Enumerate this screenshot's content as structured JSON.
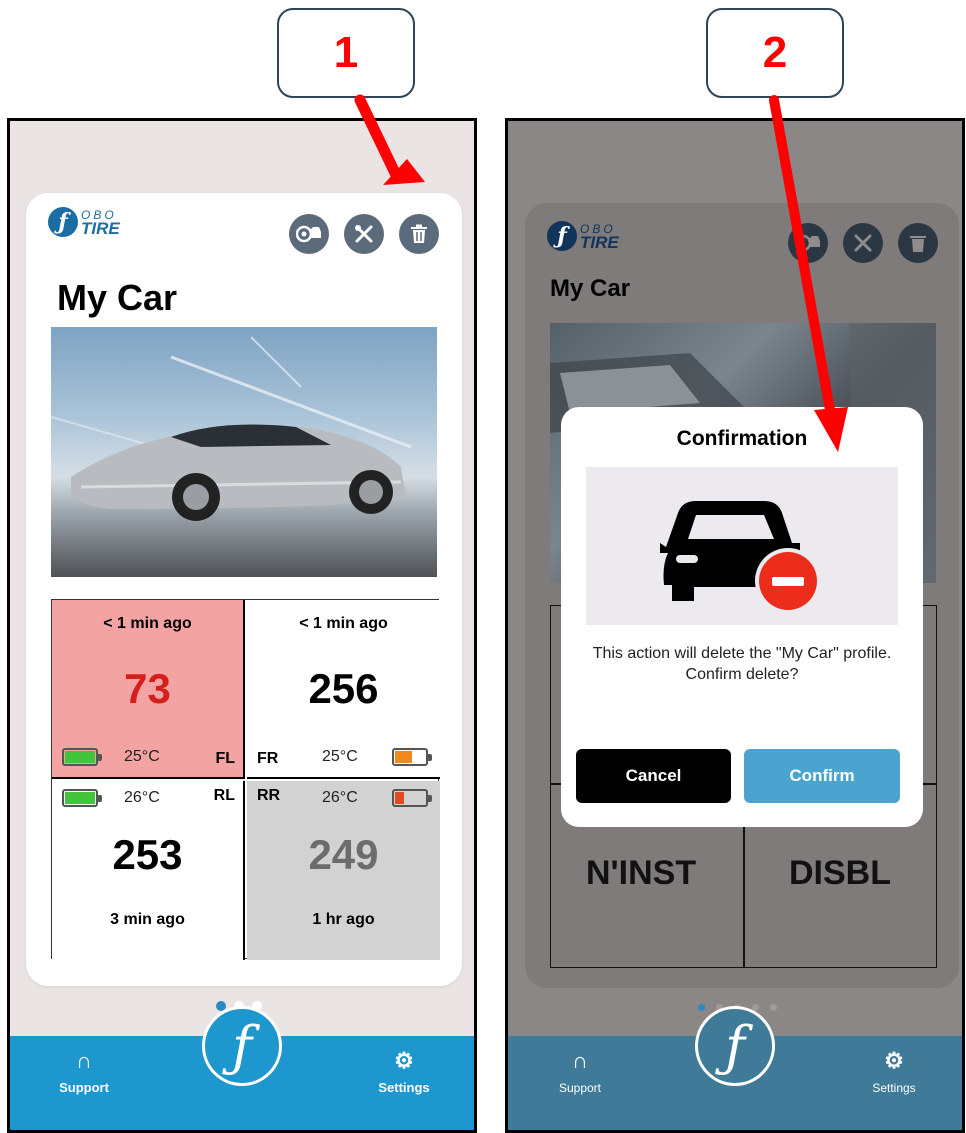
{
  "steps": [
    "1",
    "2"
  ],
  "colors": {
    "arrow": "#ff0000",
    "accent": "#1e97cf",
    "alert_cell": "#f4a3a3",
    "offline_cell": "#d2d2d2"
  },
  "logo": {
    "top": "OBO",
    "bottom": "TIRE"
  },
  "screen1": {
    "header_icons": [
      "tire-settings-icon",
      "tools-icon",
      "trash-icon"
    ],
    "car_name": "My Car",
    "tires": [
      {
        "position": "FL",
        "ago": "< 1 min ago",
        "value": "73",
        "temp": "25°C",
        "battery_level": 1.0,
        "battery_color": "#44c43b",
        "status": "alert"
      },
      {
        "position": "FR",
        "ago": "< 1 min ago",
        "value": "256",
        "temp": "25°C",
        "battery_level": 0.55,
        "battery_color": "#f08a1a",
        "status": "ok"
      },
      {
        "position": "RL",
        "ago": "3 min ago",
        "value": "253",
        "temp": "26°C",
        "battery_level": 1.0,
        "battery_color": "#44c43b",
        "status": "ok"
      },
      {
        "position": "RR",
        "ago": "1 hr ago",
        "value": "249",
        "temp": "26°C",
        "battery_level": 0.3,
        "battery_color": "#e04a1e",
        "status": "offline"
      }
    ],
    "page_dots": 3,
    "active_dot": 1
  },
  "nav": {
    "support_label": "Support",
    "settings_label": "Settings"
  },
  "screen2": {
    "car_name": "My Car",
    "tile_values": [
      "N'INST",
      "DISBL"
    ],
    "page_dots": 5,
    "active_dot": 1,
    "dialog": {
      "title": "Confirmation",
      "message": "This action will delete the \"My Car\" profile. Confirm delete?",
      "cancel_label": "Cancel",
      "confirm_label": "Confirm",
      "illustration": "car-remove-icon"
    }
  }
}
